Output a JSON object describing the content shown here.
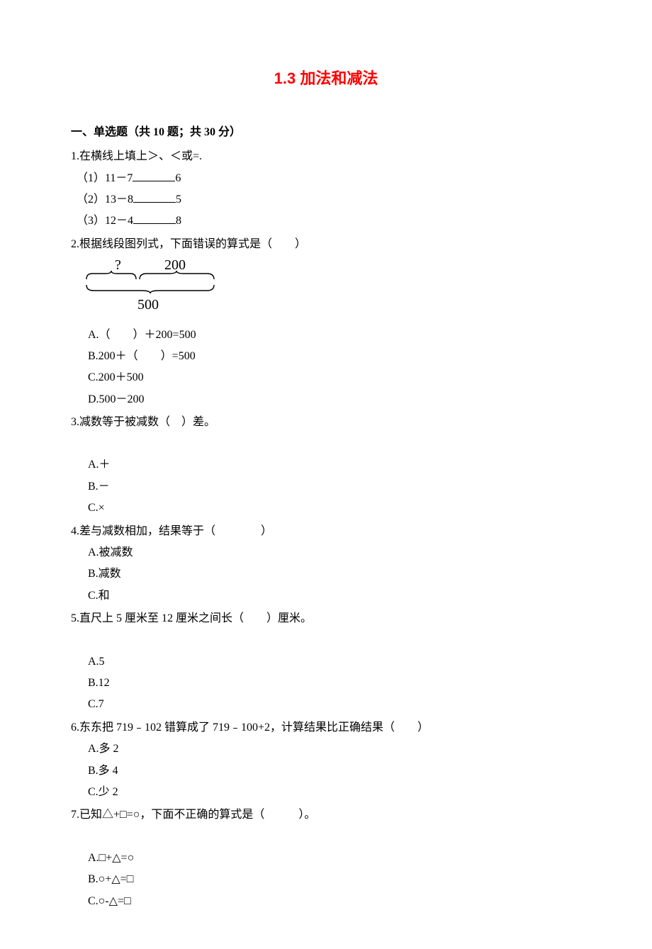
{
  "title": "1.3 加法和减法",
  "section1": {
    "heading": "一、单选题（共 10 题；共 30 分）",
    "q1": {
      "stem": "1.在横线上填上＞、＜或=.",
      "p1_prefix": "（1）11－7",
      "p1_suffix": "6",
      "p2_prefix": "（2）13－8",
      "p2_suffix": "5",
      "p3_prefix": "（3）12－4",
      "p3_suffix": "8"
    },
    "q2": {
      "stem": "2.根据线段图列式，下面错误的算式是（　　）",
      "diagram": {
        "q": "?",
        "top": "200",
        "bottom": "500"
      },
      "A": "A.（　　）＋200=500",
      "B": "B.200＋（　　）=500",
      "C": "C.200＋500",
      "D": "D.500－200"
    },
    "q3": {
      "stem": "3.减数等于被减数（　）差。",
      "A": "A.＋",
      "B": "B.－",
      "C": "C.×"
    },
    "q4": {
      "stem": "4.差与减数相加，结果等于（　　　　）",
      "A": "A.被减数",
      "B": "B.减数",
      "C": "C.和"
    },
    "q5": {
      "stem": "5.直尺上 5 厘米至 12 厘米之间长（　　）厘米。",
      "A": "A.5",
      "B": "B.12",
      "C": "C.7"
    },
    "q6": {
      "stem": "6.东东把 719﹣102 错算成了 719﹣100+2，计算结果比正确结果（　　）",
      "A": "A.多 2",
      "B": "B.多 4",
      "C": "C.少 2"
    },
    "q7": {
      "stem": "7.已知△+□=○，下面不正确的算式是（　　　）。",
      "A": "A.□+△=○",
      "B": "B.○+△=□",
      "C": "C.○-△=□"
    }
  }
}
